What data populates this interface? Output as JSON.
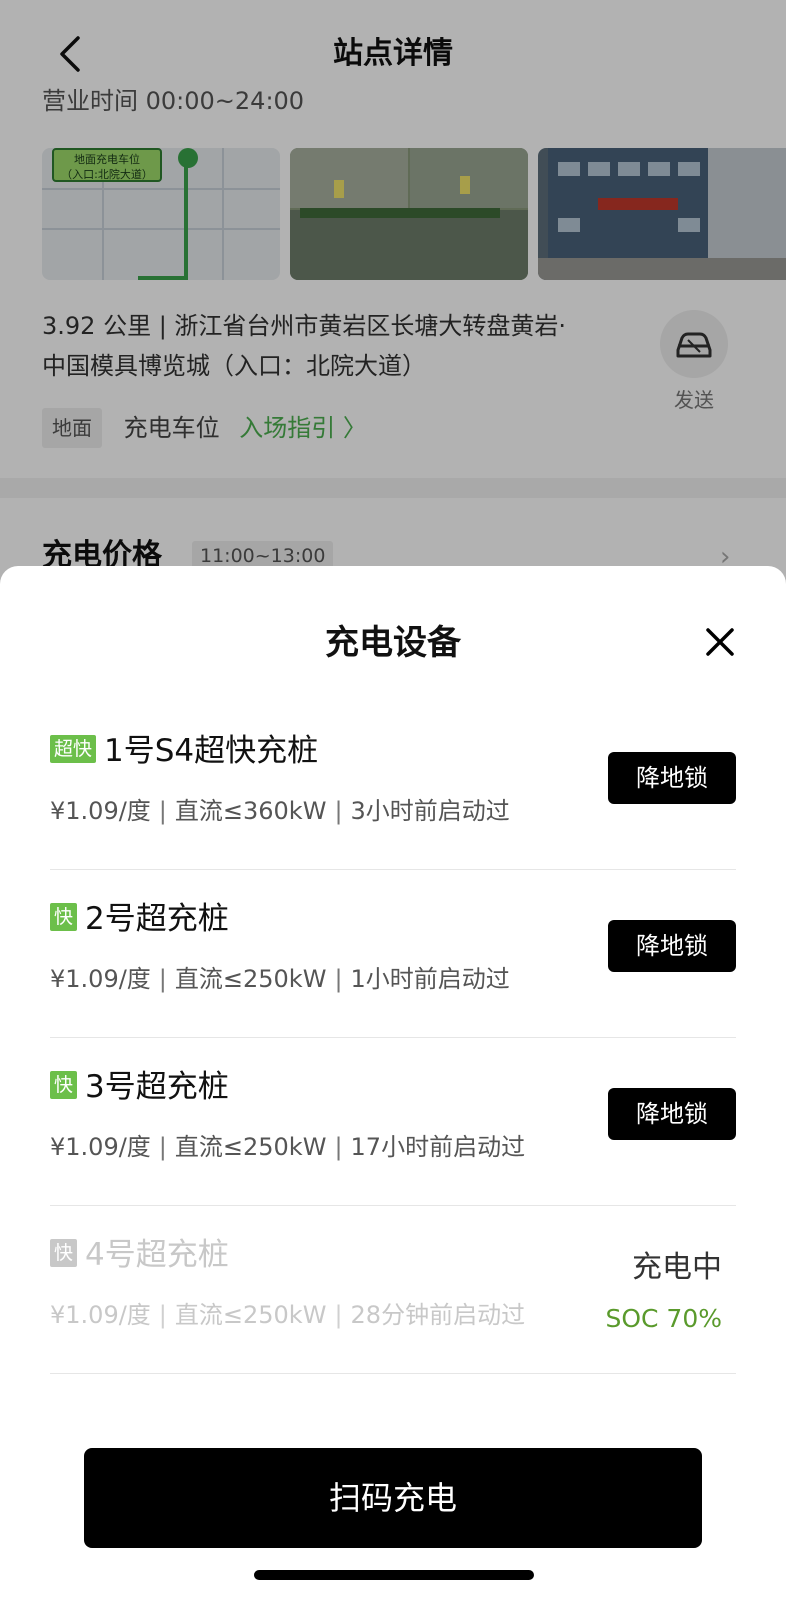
{
  "nav": {
    "title": "站点详情"
  },
  "station": {
    "hours": "营业时间 00:00~24:00",
    "map_tag": "地面充电车位\n（入口:北院大道）",
    "address_line1": "3.92 公里 | 浙江省台州市黄岩区长塘大转盘黄岩·",
    "address_line2": "中国模具博览城（入口：北院大道）",
    "send_label": "发送",
    "tag_ground": "地面",
    "tag_spot": "充电车位",
    "tag_guide": "入场指引 〉"
  },
  "price": {
    "title": "充电价格",
    "time": "11:00~13:00"
  },
  "sheet": {
    "title": "充电设备",
    "chargers": [
      {
        "badge": "超快",
        "name": "1号S4超快充桩",
        "price": "¥1.09/度",
        "power": "直流≤360kW",
        "last": "3小时前启动过",
        "action": "降地锁"
      },
      {
        "badge": "快",
        "name": "2号超充桩",
        "price": "¥1.09/度",
        "power": "直流≤250kW",
        "last": "1小时前启动过",
        "action": "降地锁"
      },
      {
        "badge": "快",
        "name": "3号超充桩",
        "price": "¥1.09/度",
        "power": "直流≤250kW",
        "last": "17小时前启动过",
        "action": "降地锁"
      },
      {
        "badge": "快",
        "name": "4号超充桩",
        "price": "¥1.09/度",
        "power": "直流≤250kW",
        "last": "28分钟前启动过",
        "status": "充电中",
        "soc": "SOC 70%"
      }
    ],
    "scan_button": "扫码充电"
  },
  "colors": {
    "accent_green": "#4caf50",
    "badge_green": "#6cbf4a",
    "soc_green": "#5a9a2c"
  }
}
